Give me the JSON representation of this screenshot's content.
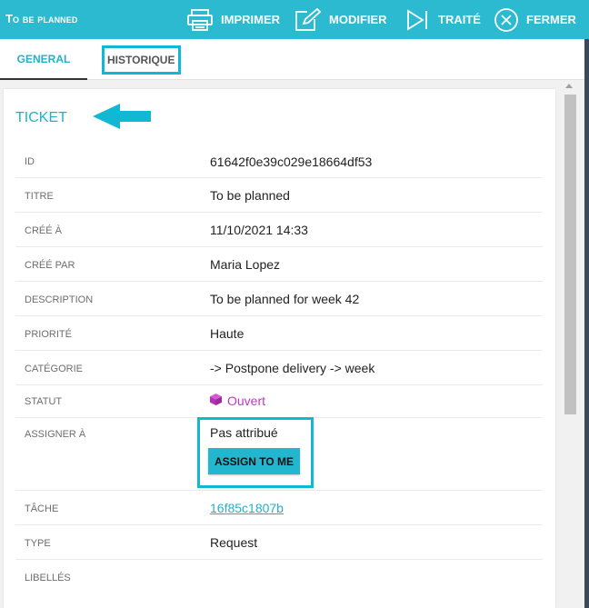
{
  "header": {
    "title": "To be planned",
    "actions": [
      {
        "label": "IMPRIMER",
        "icon": "printer-icon"
      },
      {
        "label": "MODIFIER",
        "icon": "edit-icon"
      },
      {
        "label": "TRAITÉ",
        "icon": "skip-forward-icon"
      },
      {
        "label": "FERMER",
        "icon": "close-circle-icon"
      }
    ]
  },
  "tabs": [
    {
      "label": "GENERAL",
      "active": true
    },
    {
      "label": "HISTORIQUE",
      "active": false
    }
  ],
  "ticket": {
    "section_title": "TICKET",
    "fields": [
      {
        "label": "ID",
        "value": "61642f0e39c029e18664df53"
      },
      {
        "label": "Titre",
        "value": "To be planned"
      },
      {
        "label": "Créé à",
        "value": "11/10/2021 14:33"
      },
      {
        "label": "Créé par",
        "value": "Maria Lopez"
      },
      {
        "label": "Description",
        "value": "To be planned for week 42"
      },
      {
        "label": "Priorité",
        "value": "Haute"
      },
      {
        "label": "Catégorie",
        "value": "-> Postpone delivery -> week"
      },
      {
        "label": "Statut",
        "value": "Ouvert"
      },
      {
        "label": "Assigner à",
        "value": "Pas attribué"
      },
      {
        "label": "Tâche",
        "value": "16f85c1807b"
      },
      {
        "label": "Type",
        "value": "Request"
      },
      {
        "label": "Libellés",
        "value": ""
      }
    ],
    "assign_button": "ASSIGN TO ME"
  },
  "colors": {
    "accent": "#2bbad0",
    "highlight": "#10b8d4",
    "status": "#c438c1"
  }
}
